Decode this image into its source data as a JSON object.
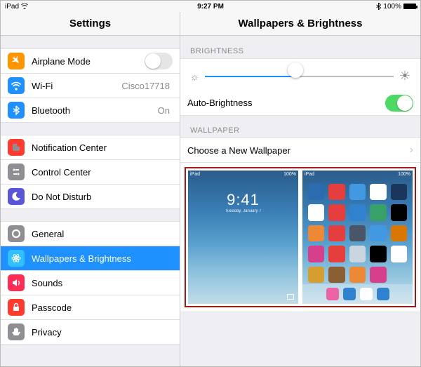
{
  "statusbar": {
    "device": "iPad",
    "time": "9:27 PM",
    "battery_pct": "100%"
  },
  "header": {
    "left": "Settings",
    "right": "Wallpapers & Brightness"
  },
  "sidebar": {
    "g1": [
      {
        "label": "Airplane Mode",
        "value": "",
        "icon": "airplane",
        "bg": "#ff9500",
        "control": "toggle",
        "on": false
      },
      {
        "label": "Wi-Fi",
        "value": "Cisco17718",
        "icon": "wifi",
        "bg": "#1e90ff"
      },
      {
        "label": "Bluetooth",
        "value": "On",
        "icon": "bluetooth",
        "bg": "#1e90ff"
      }
    ],
    "g2": [
      {
        "label": "Notification Center",
        "icon": "notify",
        "bg": "#8e8e93"
      },
      {
        "label": "Control Center",
        "icon": "control",
        "bg": "#8e8e93"
      },
      {
        "label": "Do Not Disturb",
        "icon": "moon",
        "bg": "#5856d6"
      }
    ],
    "g3": [
      {
        "label": "General",
        "icon": "gear",
        "bg": "#8e8e93"
      },
      {
        "label": "Wallpapers & Brightness",
        "icon": "atom",
        "bg": "#30c0ff",
        "selected": true
      },
      {
        "label": "Sounds",
        "icon": "sound",
        "bg": "#ff2d55"
      },
      {
        "label": "Passcode",
        "icon": "lock",
        "bg": "#ff3b30"
      },
      {
        "label": "Privacy",
        "icon": "hand",
        "bg": "#8e8e93"
      }
    ]
  },
  "detail": {
    "brightness_header": "BRIGHTNESS",
    "brightness_value_pct": 48,
    "auto_brightness_label": "Auto-Brightness",
    "auto_brightness_on": true,
    "wallpaper_header": "WALLPAPER",
    "choose_label": "Choose a New Wallpaper",
    "lock_preview": {
      "time": "9:41",
      "date": "Tuesday, January 7"
    },
    "home_preview": {
      "icon_colors": [
        "#2b6cb0",
        "#e53e3e",
        "#4299e1",
        "#ffffff",
        "#1a365d",
        "#ffffff",
        "#e53e3e",
        "#3182ce",
        "#38a169",
        "#000000",
        "#ed8936",
        "#e53e3e",
        "#4a5568",
        "#4299e1",
        "#d97706",
        "#d53f8c",
        "#e53e3e",
        "#cbd5e0",
        "#000000",
        "#ffffff",
        "#d69e2e",
        "#8b5e34",
        "#ed8936",
        "#d53f8c"
      ],
      "dock_colors": [
        "#ed64a6",
        "#3182ce",
        "#ffffff",
        "#3182ce"
      ]
    }
  }
}
